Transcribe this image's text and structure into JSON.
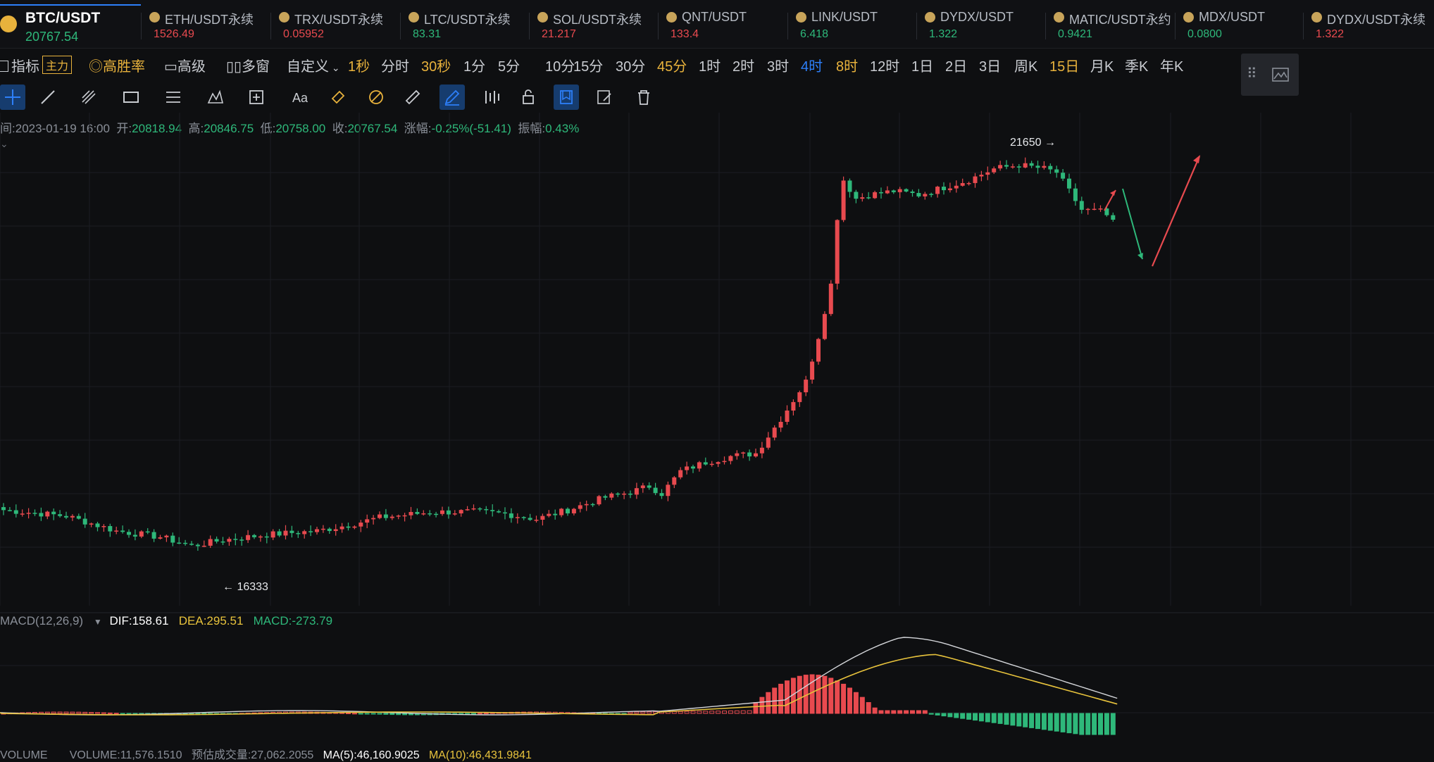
{
  "tickers": [
    {
      "symbol": "BTC/USDT",
      "price": "20767.54",
      "dir": "down",
      "main": true
    },
    {
      "symbol": "ETH/USDT永续",
      "price": "1526.49",
      "dir": "up"
    },
    {
      "symbol": "TRX/USDT永续",
      "price": "0.05952",
      "dir": "up"
    },
    {
      "symbol": "LTC/USDT永续",
      "price": "83.31",
      "dir": "down"
    },
    {
      "symbol": "SOL/USDT永续",
      "price": "21.217",
      "dir": "up"
    },
    {
      "symbol": "QNT/USDT",
      "price": "133.4",
      "dir": "up"
    },
    {
      "symbol": "LINK/USDT",
      "price": "6.418",
      "dir": "down"
    },
    {
      "symbol": "DYDX/USDT",
      "price": "1.322",
      "dir": "down"
    },
    {
      "symbol": "MATIC/USDT永约",
      "price": "0.9421",
      "dir": "down"
    },
    {
      "symbol": "MDX/USDT",
      "price": "0.0800",
      "dir": "down"
    },
    {
      "symbol": "DYDX/USDT永续",
      "price": "1.322",
      "dir": "up"
    }
  ],
  "toolbar": {
    "indicator": "指标",
    "indicator_tag": "主力",
    "win_rate": "高胜率",
    "advanced": "高级",
    "multi_window": "多窗",
    "custom": "自定义",
    "intervals": [
      "1秒",
      "分时",
      "30秒",
      "1分",
      "5分",
      "10分",
      "15分",
      "30分",
      "45分",
      "1时",
      "2时",
      "3时",
      "4时",
      "8时",
      "12时",
      "1日",
      "2日",
      "3日",
      "周K",
      "15日",
      "月K",
      "季K",
      "年K"
    ],
    "highlighted_intervals": [
      "1秒",
      "30秒",
      "45分",
      "8时",
      "15日"
    ],
    "active_interval": "4时"
  },
  "draw_tools": [
    "crosshair-tool",
    "trendline-tool",
    "fib-tool",
    "rectangle-tool",
    "parallel-channel-tool",
    "pattern-tool",
    "measure-tool",
    "text-tool",
    "eraser-tool",
    "magnet-tool",
    "ruler-tool",
    "pencil-tool",
    "indicator-tool",
    "lock-tool",
    "bookmark-tool",
    "edit-tool",
    "trash-tool"
  ],
  "ohlc": {
    "time_label": "间:",
    "time": "2023-01-19 16:00",
    "open_label": "开:",
    "open": "20818.94",
    "high_label": "高:",
    "high": "20846.75",
    "low_label": "低:",
    "low": "20758.00",
    "close_label": "收:",
    "close": "20767.54",
    "change_label": "涨幅:",
    "change": "-0.25%(-51.41)",
    "amp_label": "振幅:",
    "amp": "0.43%"
  },
  "macd": {
    "name": "MACD(12,26,9)",
    "dif": "DIF:158.61",
    "dea": "DEA:295.51",
    "macd": "MACD:-273.79"
  },
  "volume_line": {
    "name": "VOLUME",
    "vol": "VOLUME:11,576.1510",
    "est": "预估成交量:27,062.2055",
    "ma5": "MA(5):46,160.9025",
    "ma10": "MA(10):46,431.9841"
  },
  "chart_data": {
    "type": "candlestick",
    "annotations": [
      {
        "label": "21650",
        "side": "high"
      },
      {
        "label": "16333",
        "side": "low"
      }
    ],
    "high_marker": "21650",
    "low_marker": "16333",
    "colors": {
      "up": "#e84a4f",
      "down": "#2eb87a",
      "dif": "#d4d6da",
      "dea": "#e8c33c"
    },
    "price_range": [
      15600,
      22200
    ],
    "price_path_keypoints": [
      [
        0,
        16880
      ],
      [
        10,
        16800
      ],
      [
        18,
        16600
      ],
      [
        25,
        16520
      ],
      [
        30,
        16400
      ],
      [
        35,
        16480
      ],
      [
        42,
        16550
      ],
      [
        50,
        16600
      ],
      [
        55,
        16680
      ],
      [
        60,
        16780
      ],
      [
        68,
        16850
      ],
      [
        75,
        16860
      ],
      [
        80,
        16830
      ],
      [
        85,
        16760
      ],
      [
        90,
        16880
      ],
      [
        96,
        17050
      ],
      [
        100,
        17120
      ],
      [
        103,
        17200
      ],
      [
        105,
        17100
      ],
      [
        108,
        17400
      ],
      [
        112,
        17520
      ],
      [
        116,
        17600
      ],
      [
        120,
        17640
      ],
      [
        124,
        18100
      ],
      [
        128,
        18600
      ],
      [
        130,
        19200
      ],
      [
        132,
        19900
      ],
      [
        133,
        20800
      ],
      [
        134,
        21300
      ],
      [
        136,
        21050
      ],
      [
        138,
        21100
      ],
      [
        142,
        21150
      ],
      [
        146,
        21100
      ],
      [
        150,
        21200
      ],
      [
        154,
        21300
      ],
      [
        158,
        21450
      ],
      [
        162,
        21500
      ],
      [
        166,
        21450
      ],
      [
        168,
        21400
      ],
      [
        170,
        21150
      ],
      [
        172,
        20900
      ],
      [
        175,
        20880
      ],
      [
        177,
        20767
      ]
    ]
  }
}
